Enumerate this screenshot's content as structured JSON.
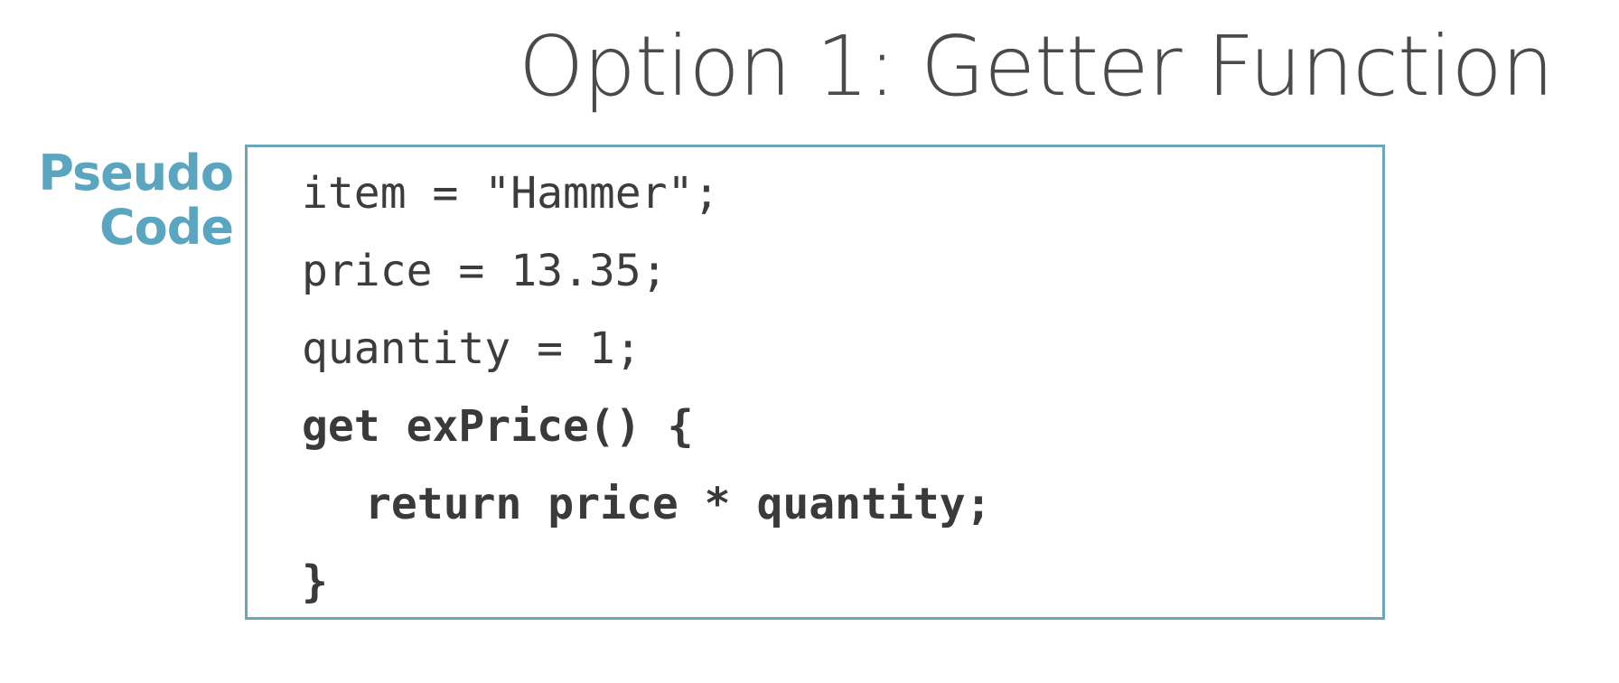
{
  "slide": {
    "title": "Option 1: Getter Function",
    "side_label": {
      "line1": "Pseudo",
      "line2": "Code"
    },
    "code_lines": [
      {
        "text": "item = \"Hammer\";",
        "bold": false,
        "indent": 0
      },
      {
        "text": "price = 13.35;",
        "bold": false,
        "indent": 0
      },
      {
        "text": "quantity = 1;",
        "bold": false,
        "indent": 0
      },
      {
        "text": "get exPrice() {",
        "bold": true,
        "indent": 0
      },
      {
        "text": "return price * quantity;",
        "bold": true,
        "indent": 1
      },
      {
        "text": "}",
        "bold": true,
        "indent": 0
      }
    ]
  },
  "colors": {
    "accent": "#5aa5bf",
    "border": "#6aa5ba",
    "text": "#4a4a4a",
    "background": "#ffffff"
  }
}
